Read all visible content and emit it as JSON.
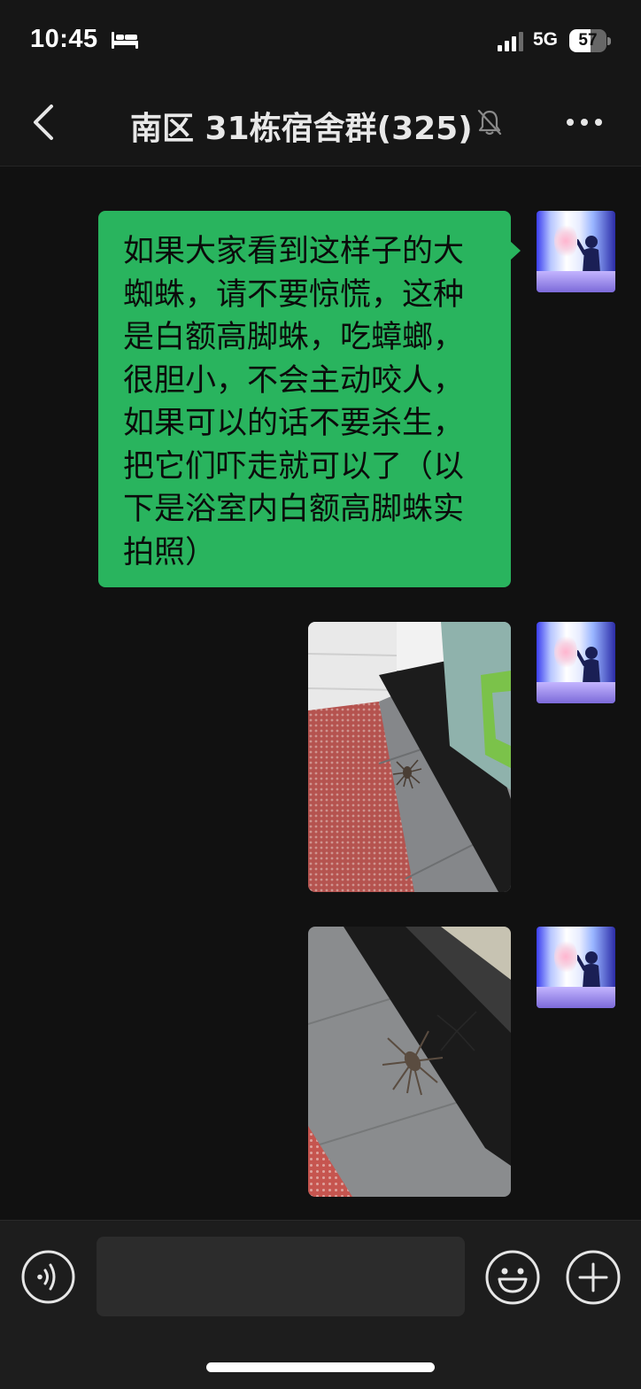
{
  "status_bar": {
    "time": "10:45",
    "sleep_icon": "bed-icon",
    "signal_icon": "cellular-signal-icon",
    "network": "5G",
    "battery_percent": "57",
    "battery_level": 0.57
  },
  "nav": {
    "back_icon": "chevron-left-icon",
    "title": "南区 31栋宿舍群(325)",
    "mute_icon": "muted-bell-icon",
    "more_icon": "more-dots-icon"
  },
  "messages": [
    {
      "type": "text",
      "sender": "self",
      "text": "如果大家看到这样子的大蜘蛛，请不要惊慌，这种是白额高脚蛛，吃蟑螂，很胆小，不会主动咬人，如果可以的话不要杀生，把它们吓走就可以了（以下是浴室内白额高脚蛛实拍照）"
    },
    {
      "type": "image",
      "sender": "self",
      "image_icon": "spider-photo-1"
    },
    {
      "type": "image",
      "sender": "self",
      "image_icon": "spider-photo-2"
    }
  ],
  "input_bar": {
    "voice_icon": "voice-input-icon",
    "input_value": "",
    "emoji_icon": "emoji-smile-icon",
    "plus_icon": "plus-circle-icon"
  },
  "colors": {
    "background": "#111111",
    "bubble": "#29b45e",
    "header": "#161616",
    "input_bar": "#1d1d1d"
  }
}
